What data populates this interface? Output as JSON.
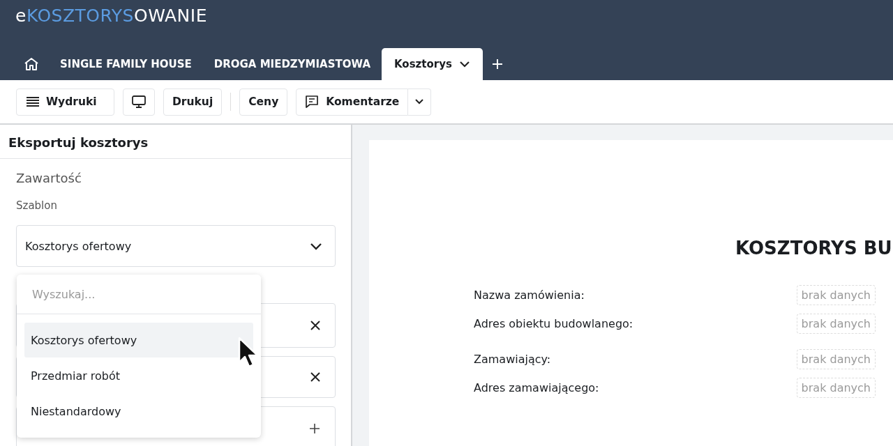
{
  "logo": [
    {
      "text": "e",
      "kind": "plain"
    },
    {
      "text": "KOSZTORYS",
      "kind": "accent"
    },
    {
      "text": "OWANIE",
      "kind": "plain"
    }
  ],
  "tabs": [
    {
      "label": "SINGLE FAMILY HOUSE",
      "selected": false
    },
    {
      "label": "DROGA MIEDZYMIASTOWA",
      "selected": false
    },
    {
      "label": "Kosztorys",
      "selected": true
    }
  ],
  "toolbar": [
    {
      "kind": "menu",
      "label": "Wydruki"
    },
    {
      "kind": "monitor"
    },
    {
      "kind": "text",
      "label": "Drukuj"
    },
    {
      "kind": "separator"
    },
    {
      "kind": "text",
      "label": "Ceny"
    },
    {
      "kind": "split",
      "label": "Komentarze"
    }
  ],
  "panel": {
    "title": "Eksportuj kosztorys",
    "section": "Zawartość",
    "field_label": "Szablon",
    "select_value": "Kosztorys ofertowy",
    "rows_behind": [
      {
        "kind": "remove"
      },
      {
        "kind": "remove"
      },
      {
        "kind": "add"
      }
    ],
    "dropdown": {
      "placeholder": "Wyszukaj...",
      "options": [
        {
          "label": "Kosztorys ofertowy",
          "selected": true
        },
        {
          "label": "Przedmiar robót",
          "selected": false
        },
        {
          "label": "Niestandardowy",
          "selected": false
        }
      ]
    }
  },
  "document": {
    "title": "KOSZTORYS BU",
    "groups": [
      [
        {
          "label": "Nazwa zamówienia:",
          "value": "brak danych"
        },
        {
          "label": "Adres obiektu budowlanego:",
          "value": "brak danych"
        }
      ],
      [
        {
          "label": "Zamawiający:",
          "value": "brak danych"
        },
        {
          "label": "Adres zamawiającego:",
          "value": "brak danych"
        }
      ]
    ]
  }
}
